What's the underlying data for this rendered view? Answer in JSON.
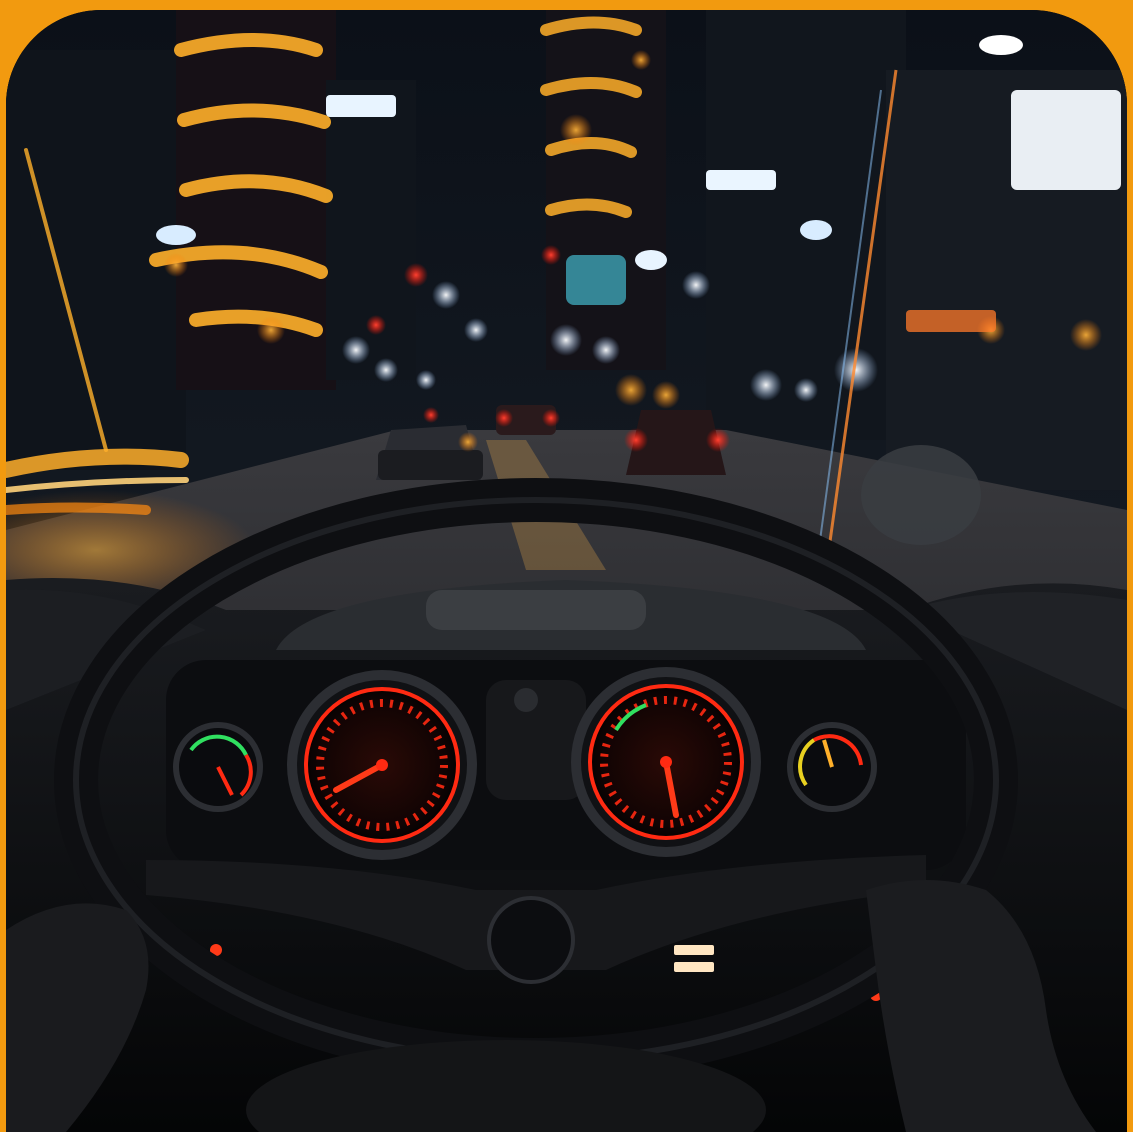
{
  "scene": {
    "description": "",
    "colors": {
      "border": "#f29a0f",
      "gauge_red": "#ff2a12",
      "light_orange": "#ff9a1c",
      "street_glow": "#ffd27a"
    },
    "elements": {
      "left_gauge_icon": "temperature-gauge-icon",
      "right_gauge_icon": "fuel-gauge-icon",
      "speedometer_icon": "speedometer-icon",
      "tachometer_icon": "tachometer-icon",
      "steering_wheel_icon": "steering-wheel-icon"
    }
  }
}
